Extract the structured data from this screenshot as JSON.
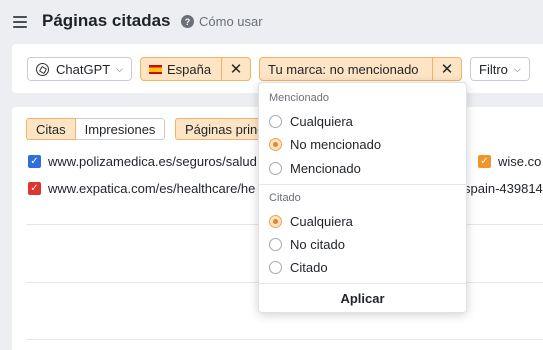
{
  "header": {
    "title": "Páginas citadas",
    "help_label": "Cómo usar"
  },
  "filters": {
    "model": "ChatGPT",
    "country": "España",
    "brand": "Tu marca: no mencionado",
    "filter_button": "Filtro"
  },
  "tabs": {
    "citas": "Citas",
    "impresiones": "Impresiones",
    "paginas": "Páginas principales"
  },
  "rows": [
    {
      "url": "www.polizamedica.es/seguros/salud",
      "color": "#2f6fdb"
    },
    {
      "url": "www.expatica.com/es/healthcare/he",
      "color": "#e0342f"
    }
  ],
  "right_col": {
    "row1": "wise.co",
    "row1_color": "#f0962b",
    "row2": "spain-439814"
  },
  "dropdown": {
    "group1_title": "Mencionado",
    "group1_options": [
      "Cualquiera",
      "No mencionado",
      "Mencionado"
    ],
    "group1_selected": "No mencionado",
    "group2_title": "Citado",
    "group2_options": [
      "Cualquiera",
      "No citado",
      "Citado"
    ],
    "group2_selected": "Cualquiera",
    "apply_label": "Aplicar"
  },
  "accent_color": "#e8842a"
}
